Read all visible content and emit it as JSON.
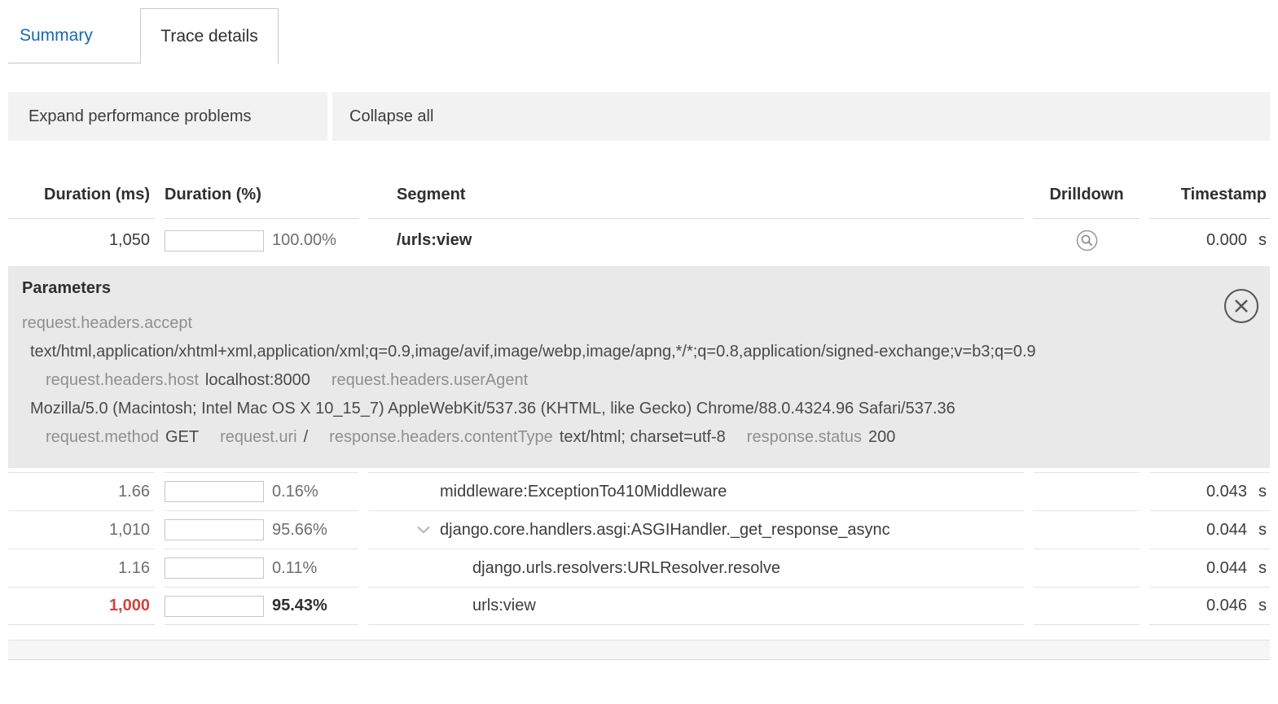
{
  "tabs": {
    "summary": "Summary",
    "trace_details": "Trace details"
  },
  "toolbar": {
    "expand_label": "Expand performance problems",
    "collapse_label": "Collapse all"
  },
  "table": {
    "headers": {
      "duration_ms": "Duration (ms)",
      "duration_pct": "Duration (%)",
      "segment": "Segment",
      "drilldown": "Drilldown",
      "timestamp": "Timestamp"
    },
    "rows": [
      {
        "duration": "1,050",
        "pct": 100,
        "pct_label": "100.00%",
        "segment": "/urls:view",
        "level": 0,
        "timestamp": "0.000",
        "unit": "s"
      },
      {
        "duration": "1.66",
        "pct": 0.16,
        "pct_label": "0.16%",
        "segment": "middleware:ExceptionTo410Middleware",
        "level": 1,
        "timestamp": "0.043",
        "unit": "s"
      },
      {
        "duration": "1,010",
        "pct": 95.66,
        "pct_label": "95.66%",
        "segment": "django.core.handlers.asgi:ASGIHandler._get_response_async",
        "level": 1,
        "timestamp": "0.044",
        "unit": "s"
      },
      {
        "duration": "1.16",
        "pct": 0.11,
        "pct_label": "0.11%",
        "segment": "django.urls.resolvers:URLResolver.resolve",
        "level": 2,
        "timestamp": "0.044",
        "unit": "s"
      },
      {
        "duration": "1,000",
        "pct": 95.43,
        "pct_label": "95.43%",
        "segment": "urls:view",
        "level": 2,
        "timestamp": "0.046",
        "unit": "s"
      }
    ]
  },
  "parameters": {
    "title": "Parameters",
    "items": [
      {
        "key": "request.headers.accept",
        "value": "text/html,application/xhtml+xml,application/xml;q=0.9,image/avif,image/webp,image/apng,*/*;q=0.8,application/signed-exchange;v=b3;q=0.9"
      },
      {
        "key": "request.headers.host",
        "value": "localhost:8000"
      },
      {
        "key": "request.headers.userAgent",
        "value": "Mozilla/5.0 (Macintosh; Intel Mac OS X 10_15_7) AppleWebKit/537.36 (KHTML, like Gecko) Chrome/88.0.4324.96 Safari/537.36"
      },
      {
        "key": "request.method",
        "value": "GET"
      },
      {
        "key": "request.uri",
        "value": "/"
      },
      {
        "key": "response.headers.contentType",
        "value": "text/html; charset=utf-8"
      },
      {
        "key": "response.status",
        "value": "200"
      }
    ]
  },
  "colors": {
    "link_blue": "#1769b5",
    "highlight_red": "#dd5a52",
    "red_text": "#cf4540",
    "bar_gray": "#e3e3e3",
    "panel_gray": "#e9e9e9"
  }
}
